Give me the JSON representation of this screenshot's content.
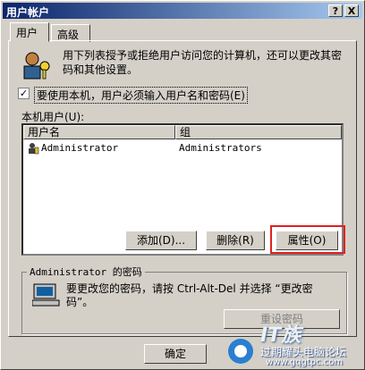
{
  "window": {
    "title": "用户帐户",
    "help_btn": "?",
    "close_btn": "X"
  },
  "tabs": [
    {
      "label": "用户"
    },
    {
      "label": "高级"
    }
  ],
  "description": "用下列表授予或拒绝用户访问您的计算机，还可以更改其密码和其他设置。",
  "require_login": {
    "label": "要使用本机，用户必须输入用户名和密码(E)",
    "checked": "✓"
  },
  "users_label": "本机用户(U):",
  "table": {
    "columns": [
      "用户名",
      "组"
    ],
    "rows": [
      {
        "name": "Administrator",
        "group": "Administrators"
      }
    ]
  },
  "buttons": {
    "add": "添加(D)...",
    "remove": "删除(R)",
    "properties": "属性(O)"
  },
  "password_group": {
    "title": "Administrator 的密码",
    "text": "要更改您的密码，请按 Ctrl-Alt-Del 并选择 “更改密码”。",
    "reset": "重设密码"
  },
  "dialog": {
    "ok": "确定"
  },
  "watermark": {
    "brand": "IT族",
    "line1": "过期耀头电脑论坛",
    "line2": "www.gqgtpc.com"
  }
}
